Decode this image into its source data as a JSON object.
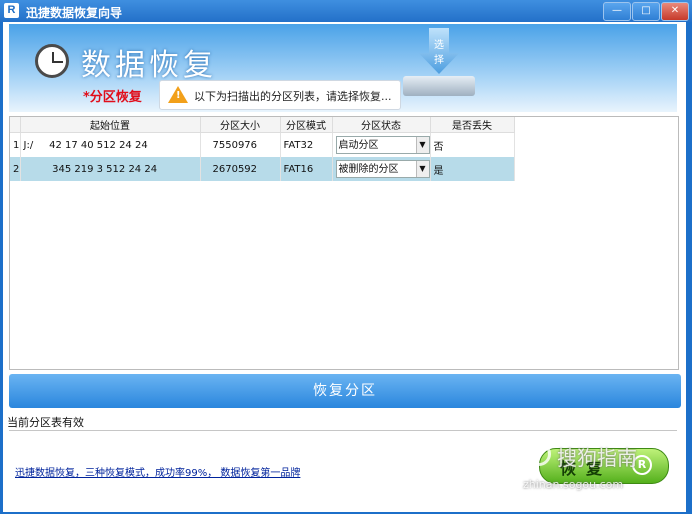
{
  "window": {
    "title": "迅捷数据恢复向导",
    "logo_letter": "R",
    "btn_minimize": "—",
    "btn_maximize": "□",
    "btn_close": "✕"
  },
  "banner": {
    "title": "数据恢复",
    "disk_label": "选择",
    "section": "*分区恢复",
    "tip": "以下为扫描出的分区列表，请选择恢复...",
    "warning_glyph": "!"
  },
  "table": {
    "columns": [
      "",
      "起始位置",
      "分区大小",
      "分区模式",
      "分区状态",
      "是否丢失"
    ],
    "rows": [
      {
        "index": "1",
        "drive": "J:/",
        "start": "42  17 40   512  24 24",
        "size": "7550976",
        "mode": "FAT32",
        "state": "启动分区",
        "lost": "否"
      },
      {
        "index": "2",
        "drive": "",
        "start": "345 219  3   512  24 24",
        "size": "2670592",
        "mode": "FAT16",
        "state": "被删除的分区",
        "lost": "是"
      }
    ],
    "combo_arrow": "▼"
  },
  "recover_button": "恢复分区",
  "status_text": "当前分区表有效",
  "promo_text": "迅捷数据恢复，三种恢复模式，成功率99%， 数据恢复第一品牌",
  "restore_button": {
    "label": "恢复",
    "badge": "R"
  },
  "watermark": {
    "main": "搜狗指南",
    "sub": "zhinan.sogou.com"
  },
  "colors": {
    "accent": "#2a86dd",
    "section_red": "#e10d1a",
    "selected_row": "#b7dbe9",
    "restore_green": "#54b01c"
  }
}
